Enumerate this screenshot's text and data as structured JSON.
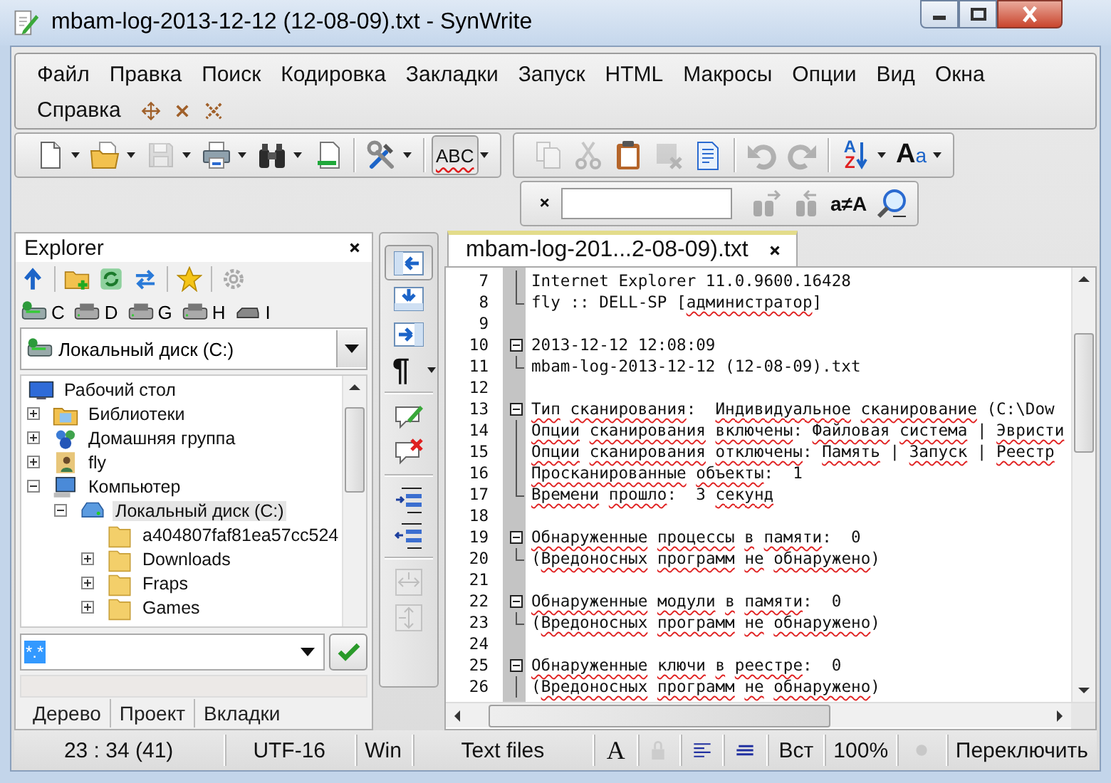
{
  "window": {
    "title": "mbam-log-2013-12-12 (12-08-09).txt - SynWrite"
  },
  "menu_rows": [
    [
      "Файл",
      "Правка",
      "Поиск",
      "Кодировка",
      "Закладки",
      "Запуск",
      "HTML",
      "Макросы",
      "Опции",
      "Вид",
      "Окна"
    ],
    [
      "Справка"
    ]
  ],
  "toolbars": [
    {
      "items": [
        {
          "kind": "new",
          "caret": true,
          "disabled": false
        },
        {
          "kind": "open",
          "caret": true,
          "disabled": false
        },
        {
          "kind": "save",
          "caret": true,
          "disabled": true
        },
        {
          "kind": "print",
          "caret": true,
          "disabled": false
        },
        {
          "kind": "find",
          "caret": true,
          "disabled": false
        },
        {
          "kind": "goto",
          "disabled": false
        },
        {
          "kind": "separator"
        },
        {
          "kind": "tools",
          "caret": true,
          "disabled": false
        },
        {
          "kind": "separator"
        },
        {
          "kind": "spellcheck",
          "label": "ABC",
          "caret": true,
          "disabled": false,
          "checked": true
        }
      ]
    },
    {
      "items": [
        {
          "kind": "copy",
          "disabled": true
        },
        {
          "kind": "cut",
          "disabled": true
        },
        {
          "kind": "paste",
          "disabled": false
        },
        {
          "kind": "delete",
          "disabled": true
        },
        {
          "kind": "props",
          "disabled": false
        },
        {
          "kind": "separator"
        },
        {
          "kind": "undo",
          "disabled": true
        },
        {
          "kind": "redo",
          "disabled": true
        },
        {
          "kind": "separator"
        },
        {
          "kind": "sort",
          "labels": [
            "A",
            "Z"
          ],
          "caret": true,
          "disabled": false
        },
        {
          "kind": "font",
          "labels": [
            "A",
            "a"
          ],
          "caret": true,
          "disabled": false
        }
      ]
    }
  ],
  "search_bar": {
    "items": [
      {
        "kind": "find-next",
        "disabled": true
      },
      {
        "kind": "find-prev",
        "disabled": true
      },
      {
        "kind": "match-case",
        "label": "a≠A",
        "disabled": false
      },
      {
        "kind": "search",
        "disabled": false
      }
    ]
  },
  "explorer": {
    "title": "Explorer",
    "drives": [
      {
        "letter": "C",
        "kind": "system"
      },
      {
        "letter": "D",
        "kind": "dvd"
      },
      {
        "letter": "G",
        "kind": "dvd"
      },
      {
        "letter": "H",
        "kind": "dvd"
      },
      {
        "letter": "I",
        "kind": "removable"
      }
    ],
    "drive_combo": "Локальный диск (C:)",
    "tree": [
      {
        "label": "Рабочий стол",
        "kind": "desktop",
        "selected": false,
        "children": [
          {
            "label": "Библиотеки",
            "kind": "library",
            "expanded": false,
            "selected": false
          },
          {
            "label": "Домашняя группа",
            "kind": "homegroup",
            "expanded": false,
            "selected": false
          },
          {
            "label": "fly",
            "kind": "user",
            "expanded": false,
            "selected": false
          },
          {
            "label": "Компьютер",
            "kind": "computer",
            "expanded": true,
            "selected": false,
            "children": [
              {
                "label": "Локальный диск (C:)",
                "kind": "drive",
                "expanded": true,
                "selected": true,
                "children": [
                  {
                    "label": "a404807faf81ea57cc524",
                    "kind": "folder",
                    "selected": false
                  },
                  {
                    "label": "Downloads",
                    "kind": "folder",
                    "expanded": false,
                    "selected": false
                  },
                  {
                    "label": "Fraps",
                    "kind": "folder",
                    "expanded": false,
                    "selected": false
                  },
                  {
                    "label": "Games",
                    "kind": "folder",
                    "expanded": false,
                    "selected": false
                  }
                ]
              }
            ]
          }
        ]
      }
    ],
    "filter": {
      "value": "*.*",
      "highlighted": true
    },
    "tabs": [
      {
        "label": "Дерево"
      },
      {
        "label": "Проект"
      },
      {
        "label": "Вкладки"
      }
    ]
  },
  "side_toolbar": [
    {
      "kind": "tree-left",
      "checked": true
    },
    {
      "kind": "tree-bottom",
      "checked": false
    },
    {
      "kind": "tree-right",
      "checked": false
    },
    {
      "kind": "pilcrow",
      "label": "¶",
      "caret": true
    },
    {
      "kind": "separator"
    },
    {
      "kind": "comment",
      "disabled": false
    },
    {
      "kind": "uncomment",
      "disabled": false
    },
    {
      "kind": "separator"
    },
    {
      "kind": "indent",
      "disabled": false
    },
    {
      "kind": "unindent",
      "disabled": false
    },
    {
      "kind": "separator"
    },
    {
      "kind": "split-h",
      "disabled": true
    },
    {
      "kind": "split-v",
      "disabled": true
    }
  ],
  "editor": {
    "tabs": [
      {
        "label": "mbam-log-201...2-08-09).txt",
        "selected": true
      }
    ],
    "lines": [
      {
        "number": "7",
        "text": "Internet Explorer 11.0.9600.16428",
        "kind": "inside"
      },
      {
        "number": "8",
        "text": "fly :: DELL-SP [администратор]",
        "kind": "end"
      },
      {
        "number": "9",
        "kind": "plain"
      },
      {
        "number": "10",
        "text": "2013-12-12 12:08:09",
        "kind": "start"
      },
      {
        "number": "11",
        "text": "mbam-log-2013-12-12 (12-08-09).txt",
        "kind": "end"
      },
      {
        "number": "12",
        "kind": "plain"
      },
      {
        "number": "13",
        "text": "Тип сканирования:  Индивидуальное сканирование (C:\\Dow",
        "kind": "start"
      },
      {
        "number": "14",
        "text": "Опции сканирования включены: Файловая система | Эвристи",
        "kind": "inside"
      },
      {
        "number": "15",
        "text": "Опции сканирования отключены: Память | Запуск | Реестр",
        "kind": "inside"
      },
      {
        "number": "16",
        "text": "Просканированные объекты:  1",
        "kind": "inside"
      },
      {
        "number": "17",
        "text": "Времени прошло:  3 секунд",
        "kind": "end"
      },
      {
        "number": "18",
        "kind": "plain"
      },
      {
        "number": "19",
        "text": "Обнаруженные процессы в памяти:  0",
        "kind": "start"
      },
      {
        "number": "20",
        "text": "(Вредоносных программ не обнаружено)",
        "kind": "end"
      },
      {
        "number": "21",
        "kind": "plain"
      },
      {
        "number": "22",
        "text": "Обнаруженные модули в памяти:  0",
        "kind": "start"
      },
      {
        "number": "23",
        "text": "(Вредоносных программ не обнаружено)",
        "kind": "end"
      },
      {
        "number": "24",
        "kind": "plain"
      },
      {
        "number": "25",
        "text": "Обнаруженные ключи в реестре:  0",
        "kind": "start"
      },
      {
        "number": "26",
        "text": "(Вредоносных программ не обнаружено)",
        "kind": "inside"
      }
    ]
  },
  "status_bar": {
    "position": "23 : 34 (41)",
    "encoding": "UTF-16",
    "line_ends": "Win",
    "lexer": "Text files",
    "font_glyph": "A",
    "insert_mode": "Вст",
    "zoom": "100%",
    "switch_label": "Переключить"
  }
}
